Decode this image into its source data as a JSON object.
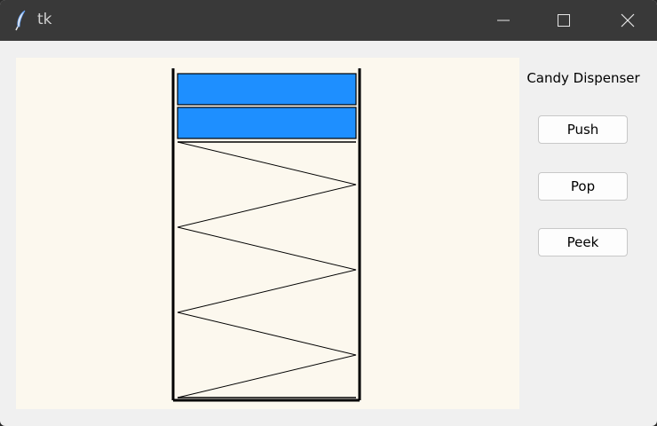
{
  "window": {
    "title": "tk",
    "icon": "feather-icon",
    "controls": [
      "minimize-icon",
      "maximize-icon",
      "close-icon"
    ]
  },
  "colors": {
    "canvas_bg": "#fcf8ee",
    "candy": "#1e8fff",
    "titlebar": "#393939",
    "window_bg": "#f0f0f0"
  },
  "dispenser": {
    "candy_count": 2,
    "spring_folds": 6
  },
  "sidebar": {
    "label": "Candy Dispenser",
    "push_label": "Push",
    "pop_label": "Pop",
    "peek_label": "Peek"
  }
}
